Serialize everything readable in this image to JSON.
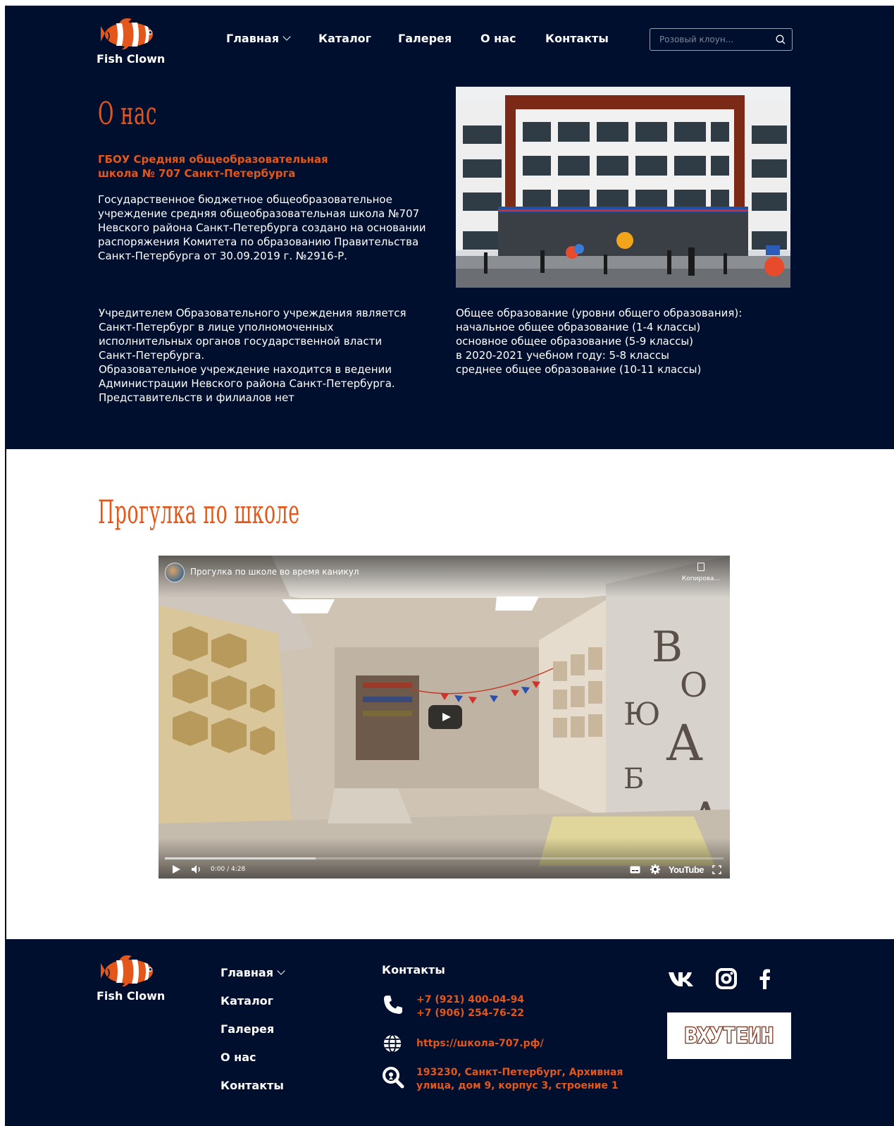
{
  "brand": {
    "name": "Fish Clown",
    "accent": "#e4571b",
    "dark": "#000f2e"
  },
  "header": {
    "nav": [
      {
        "label": "Главная",
        "dropdown": true
      },
      {
        "label": "Каталог"
      },
      {
        "label": "Галерея"
      },
      {
        "label": "О нас"
      },
      {
        "label": "Контакты"
      }
    ],
    "search_placeholder": "Розовый клоун..."
  },
  "about": {
    "title": "О нас",
    "subtitle": "ГБОУ Средняя общеобразовательная школа № 707 Санкт-Петербурга",
    "intro": "Государственное бюджетное общеобразовательное учреждение средняя общеобразовательная школа №707 Невского района Санкт-Петербурга создано на основании распоряжения Комитета по образованию Правительства Санкт-Петербурга от 30.09.2019 г. №2916-Р.",
    "founder": [
      "Учредителем Образовательного учреждения является",
      "Санкт-Петербург в лице уполномоченных",
      "исполнительных органов государственной власти",
      "Санкт-Петербурга.",
      "Образовательное учреждение находится в ведении",
      "Администрации Невского района Санкт-Петербурга.",
      "Представительств и филиалов нет"
    ],
    "education": [
      "Общее образование (уровни общего образования):",
      "начальное общее образование (1-4 классы)",
      "основное общее образование (5-9 классы)",
      "в 2020-2021 учебном году: 5-8 классы",
      "среднее общее образование (10-11 классы)"
    ]
  },
  "tour": {
    "title": "Прогулка по школе",
    "video": {
      "title": "Прогулка по школе во время каникул",
      "copy_label": "Копирова...",
      "time": "0:00 / 4:28",
      "progress": 0.0,
      "buffered": 0.27,
      "provider": "YouTube"
    }
  },
  "footer": {
    "nav": [
      "Главная",
      "Каталог",
      "Галерея",
      "О нас",
      "Контакты"
    ],
    "contacts_title": "Контакты",
    "phone1": "+7 (921) 400-04-94",
    "phone2": "+7 (906) 254-76-22",
    "website": "https://школа-707.рф/",
    "address": "193230, Санкт-Петербург, Архивная улица, дом 9, корпус 3, строение 1",
    "social": [
      "vk-icon",
      "instagram-icon",
      "facebook-icon"
    ],
    "partner_logo": "ВХУТЕИН"
  }
}
